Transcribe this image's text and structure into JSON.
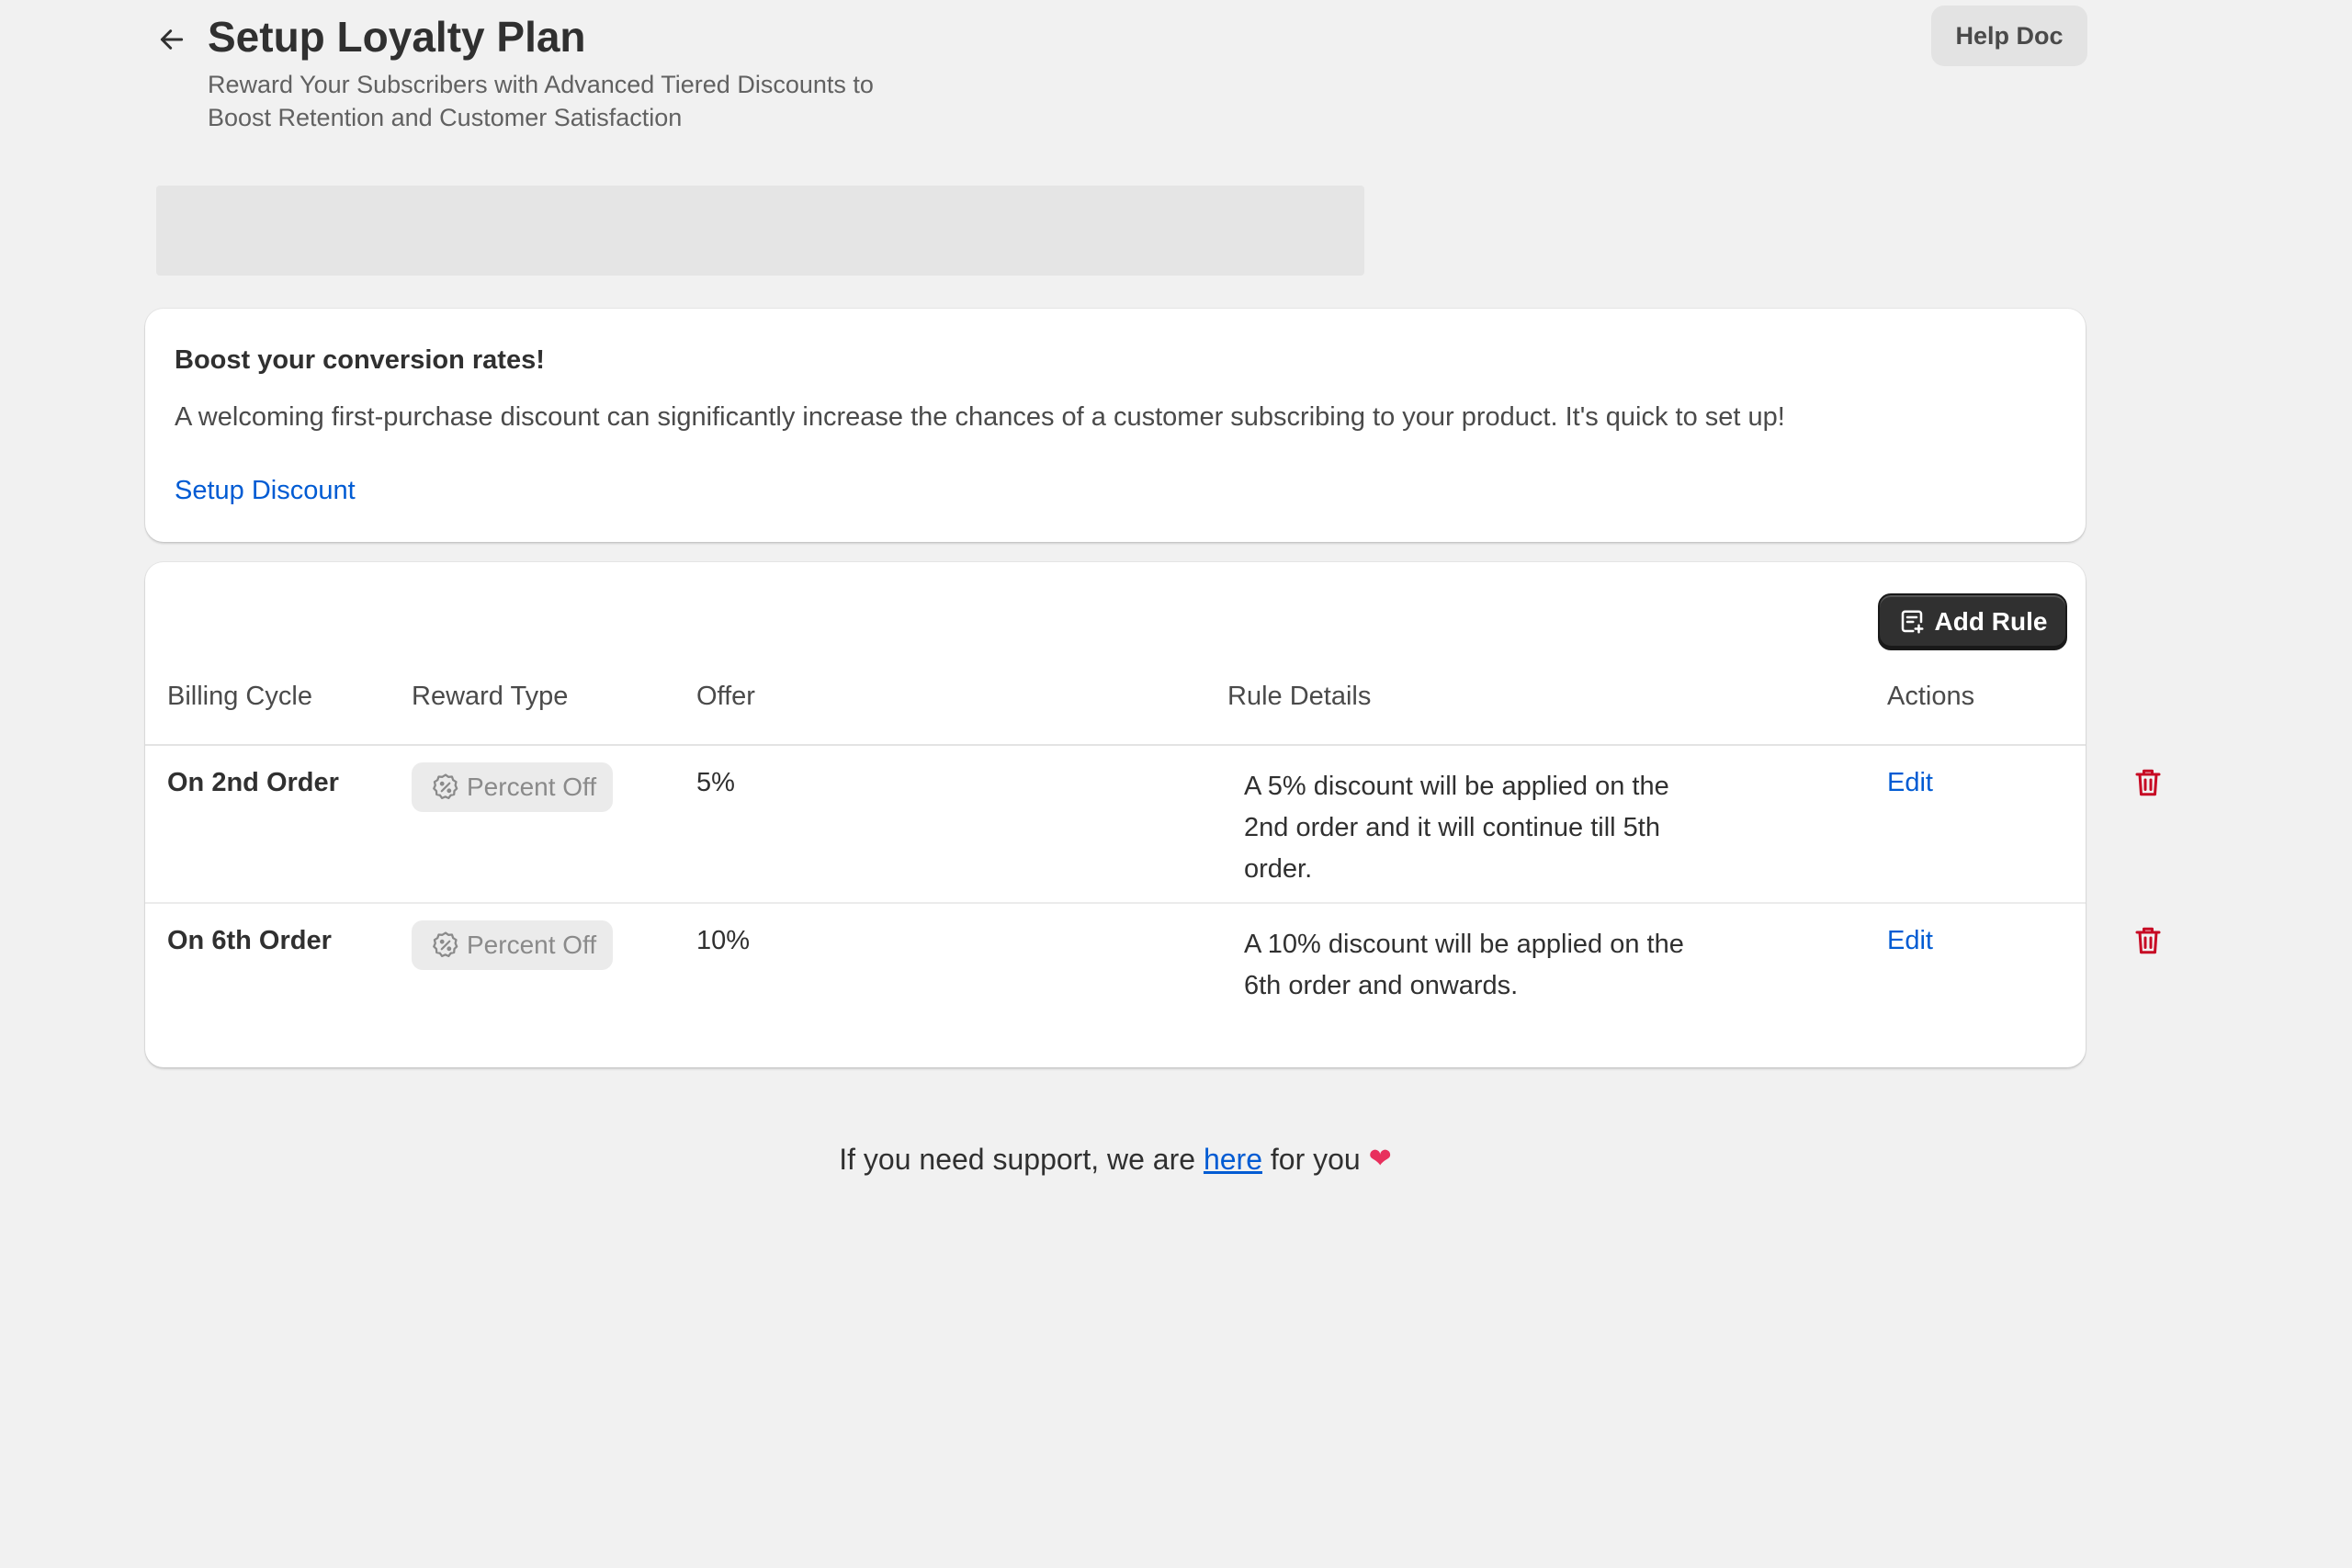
{
  "header": {
    "title": "Setup Loyalty Plan",
    "subtitle_line1": "Reward Your Subscribers with Advanced Tiered Discounts to",
    "subtitle_line2": "Boost Retention and Customer Satisfaction",
    "help_label": "Help Doc"
  },
  "banner": {
    "title": "Boost your conversion rates!",
    "text": "A welcoming first-purchase discount can significantly increase the chances of a customer subscribing to your product. It's quick to set up!",
    "link_label": "Setup Discount"
  },
  "rules": {
    "add_rule_label": "Add Rule",
    "columns": {
      "billing_cycle": "Billing Cycle",
      "reward_type": "Reward Type",
      "offer": "Offer",
      "rule_details": "Rule Details",
      "actions": "Actions"
    },
    "rows": [
      {
        "billing_cycle": "On 2nd Order",
        "reward_type": "Percent Off",
        "offer": "5%",
        "details_line1": "A 5% discount will be applied on the",
        "details_line2": "2nd order and it will continue till 5th",
        "details_line3": "order.",
        "edit_label": "Edit"
      },
      {
        "billing_cycle": "On 6th Order",
        "reward_type": "Percent Off",
        "offer": "10%",
        "details_line1": "A 10% discount will be applied on the",
        "details_line2": "6th order and onwards.",
        "edit_label": "Edit"
      }
    ]
  },
  "footer": {
    "prefix": "If you need support, we are",
    "link": "here",
    "suffix": "for you"
  },
  "colors": {
    "page_bg": "#f1f1f1",
    "link": "#005bd3",
    "primary_button": "#303030",
    "delete_icon": "#c70a24",
    "heart": "#e8305d"
  },
  "icons": [
    "arrow-left-icon",
    "discount-badge-icon",
    "add-rule-icon",
    "trash-icon",
    "heart-icon"
  ]
}
